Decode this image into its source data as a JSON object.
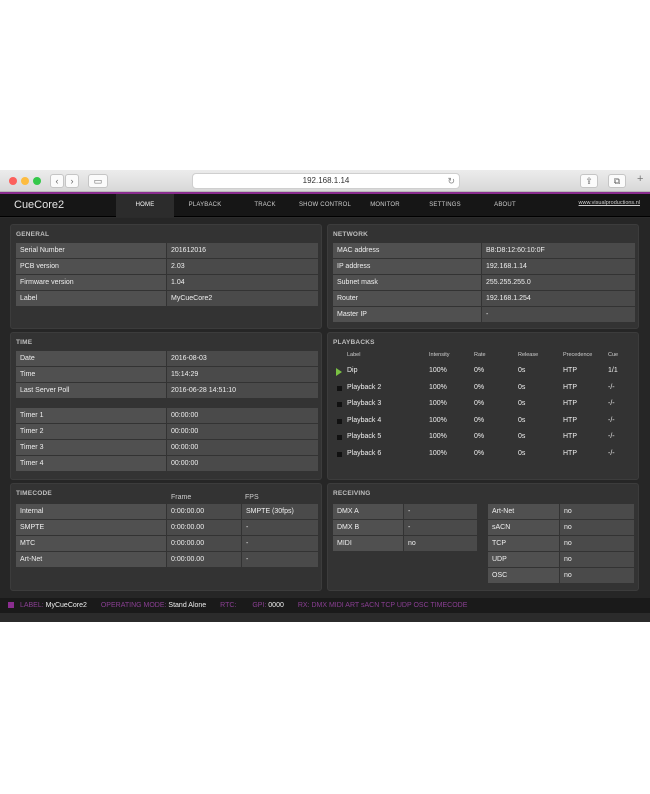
{
  "browser": {
    "url": "192.168.1.14"
  },
  "nav": {
    "brand": "CueCore2",
    "tabs": [
      "HOME",
      "PLAYBACK",
      "TRACK",
      "SHOW CONTROL",
      "MONITOR",
      "SETTINGS",
      "ABOUT"
    ],
    "site_link": "www.visualproductions.nl"
  },
  "general": {
    "title": "GENERAL",
    "rows": [
      {
        "label": "Serial Number",
        "value": "201612016"
      },
      {
        "label": "PCB version",
        "value": "2.03"
      },
      {
        "label": "Firmware version",
        "value": "1.04"
      },
      {
        "label": "Label",
        "value": "MyCueCore2"
      }
    ]
  },
  "network": {
    "title": "NETWORK",
    "rows": [
      {
        "label": "MAC address",
        "value": "B8:D8:12:60:10:0F"
      },
      {
        "label": "IP address",
        "value": "192.168.1.14"
      },
      {
        "label": "Subnet mask",
        "value": "255.255.255.0"
      },
      {
        "label": "Router",
        "value": "192.168.1.254"
      },
      {
        "label": "Master IP",
        "value": "-"
      }
    ]
  },
  "time": {
    "title": "TIME",
    "rows": [
      {
        "label": "Date",
        "value": "2016-08-03"
      },
      {
        "label": "Time",
        "value": "15:14:29"
      },
      {
        "label": "Last Server Poll",
        "value": "2016-06-28 14:51:10"
      }
    ],
    "timers": [
      {
        "label": "Timer 1",
        "value": "00:00:00"
      },
      {
        "label": "Timer 2",
        "value": "00:00:00"
      },
      {
        "label": "Timer 3",
        "value": "00:00:00"
      },
      {
        "label": "Timer 4",
        "value": "00:00:00"
      }
    ]
  },
  "playbacks": {
    "title": "PLAYBACKS",
    "headers": [
      "Label",
      "Intensity",
      "Rate",
      "Release",
      "Precedence",
      "Cue"
    ],
    "rows": [
      {
        "label": "Dip",
        "intensity": "100%",
        "rate": "0%",
        "release": "0s",
        "precedence": "HTP",
        "cue": "1/1",
        "state": "playing"
      },
      {
        "label": "Playback 2",
        "intensity": "100%",
        "rate": "0%",
        "release": "0s",
        "precedence": "HTP",
        "cue": "-/-",
        "state": "stopped"
      },
      {
        "label": "Playback 3",
        "intensity": "100%",
        "rate": "0%",
        "release": "0s",
        "precedence": "HTP",
        "cue": "-/-",
        "state": "stopped"
      },
      {
        "label": "Playback 4",
        "intensity": "100%",
        "rate": "0%",
        "release": "0s",
        "precedence": "HTP",
        "cue": "-/-",
        "state": "stopped"
      },
      {
        "label": "Playback 5",
        "intensity": "100%",
        "rate": "0%",
        "release": "0s",
        "precedence": "HTP",
        "cue": "-/-",
        "state": "stopped"
      },
      {
        "label": "Playback 6",
        "intensity": "100%",
        "rate": "0%",
        "release": "0s",
        "precedence": "HTP",
        "cue": "-/-",
        "state": "stopped"
      }
    ]
  },
  "timecode": {
    "title": "TIMECODE",
    "headers": [
      "Frame",
      "FPS"
    ],
    "rows": [
      {
        "label": "Internal",
        "frame": "0:00:00.00",
        "fps": "SMPTE (30fps)"
      },
      {
        "label": "SMPTE",
        "frame": "0:00:00.00",
        "fps": "-"
      },
      {
        "label": "MTC",
        "frame": "0:00:00.00",
        "fps": "-"
      },
      {
        "label": "Art-Net",
        "frame": "0:00:00.00",
        "fps": "-"
      }
    ]
  },
  "receiving": {
    "title": "RECEIVING",
    "left": [
      {
        "label": "DMX A",
        "value": "-"
      },
      {
        "label": "DMX B",
        "value": "-"
      },
      {
        "label": "MIDI",
        "value": "no"
      }
    ],
    "right": [
      {
        "label": "Art-Net",
        "value": "no"
      },
      {
        "label": "sACN",
        "value": "no"
      },
      {
        "label": "TCP",
        "value": "no"
      },
      {
        "label": "UDP",
        "value": "no"
      },
      {
        "label": "OSC",
        "value": "no"
      }
    ]
  },
  "status": {
    "label_key": "LABEL:",
    "label_value": "MyCueCore2",
    "mode_key": "OPERATING MODE:",
    "mode_value": "Stand Alone",
    "rtc_key": "RTC:",
    "gpi_key": "GPI:",
    "gpi_value": "0000",
    "rx_key": "RX:",
    "rx_value": "DMX MIDI ART sACN TCP UDP OSC TIMECODE"
  },
  "colors": {
    "accent": "#8a2d8f",
    "play": "#7ac143",
    "panel": "#333333",
    "cell": "#4a4a4a"
  }
}
